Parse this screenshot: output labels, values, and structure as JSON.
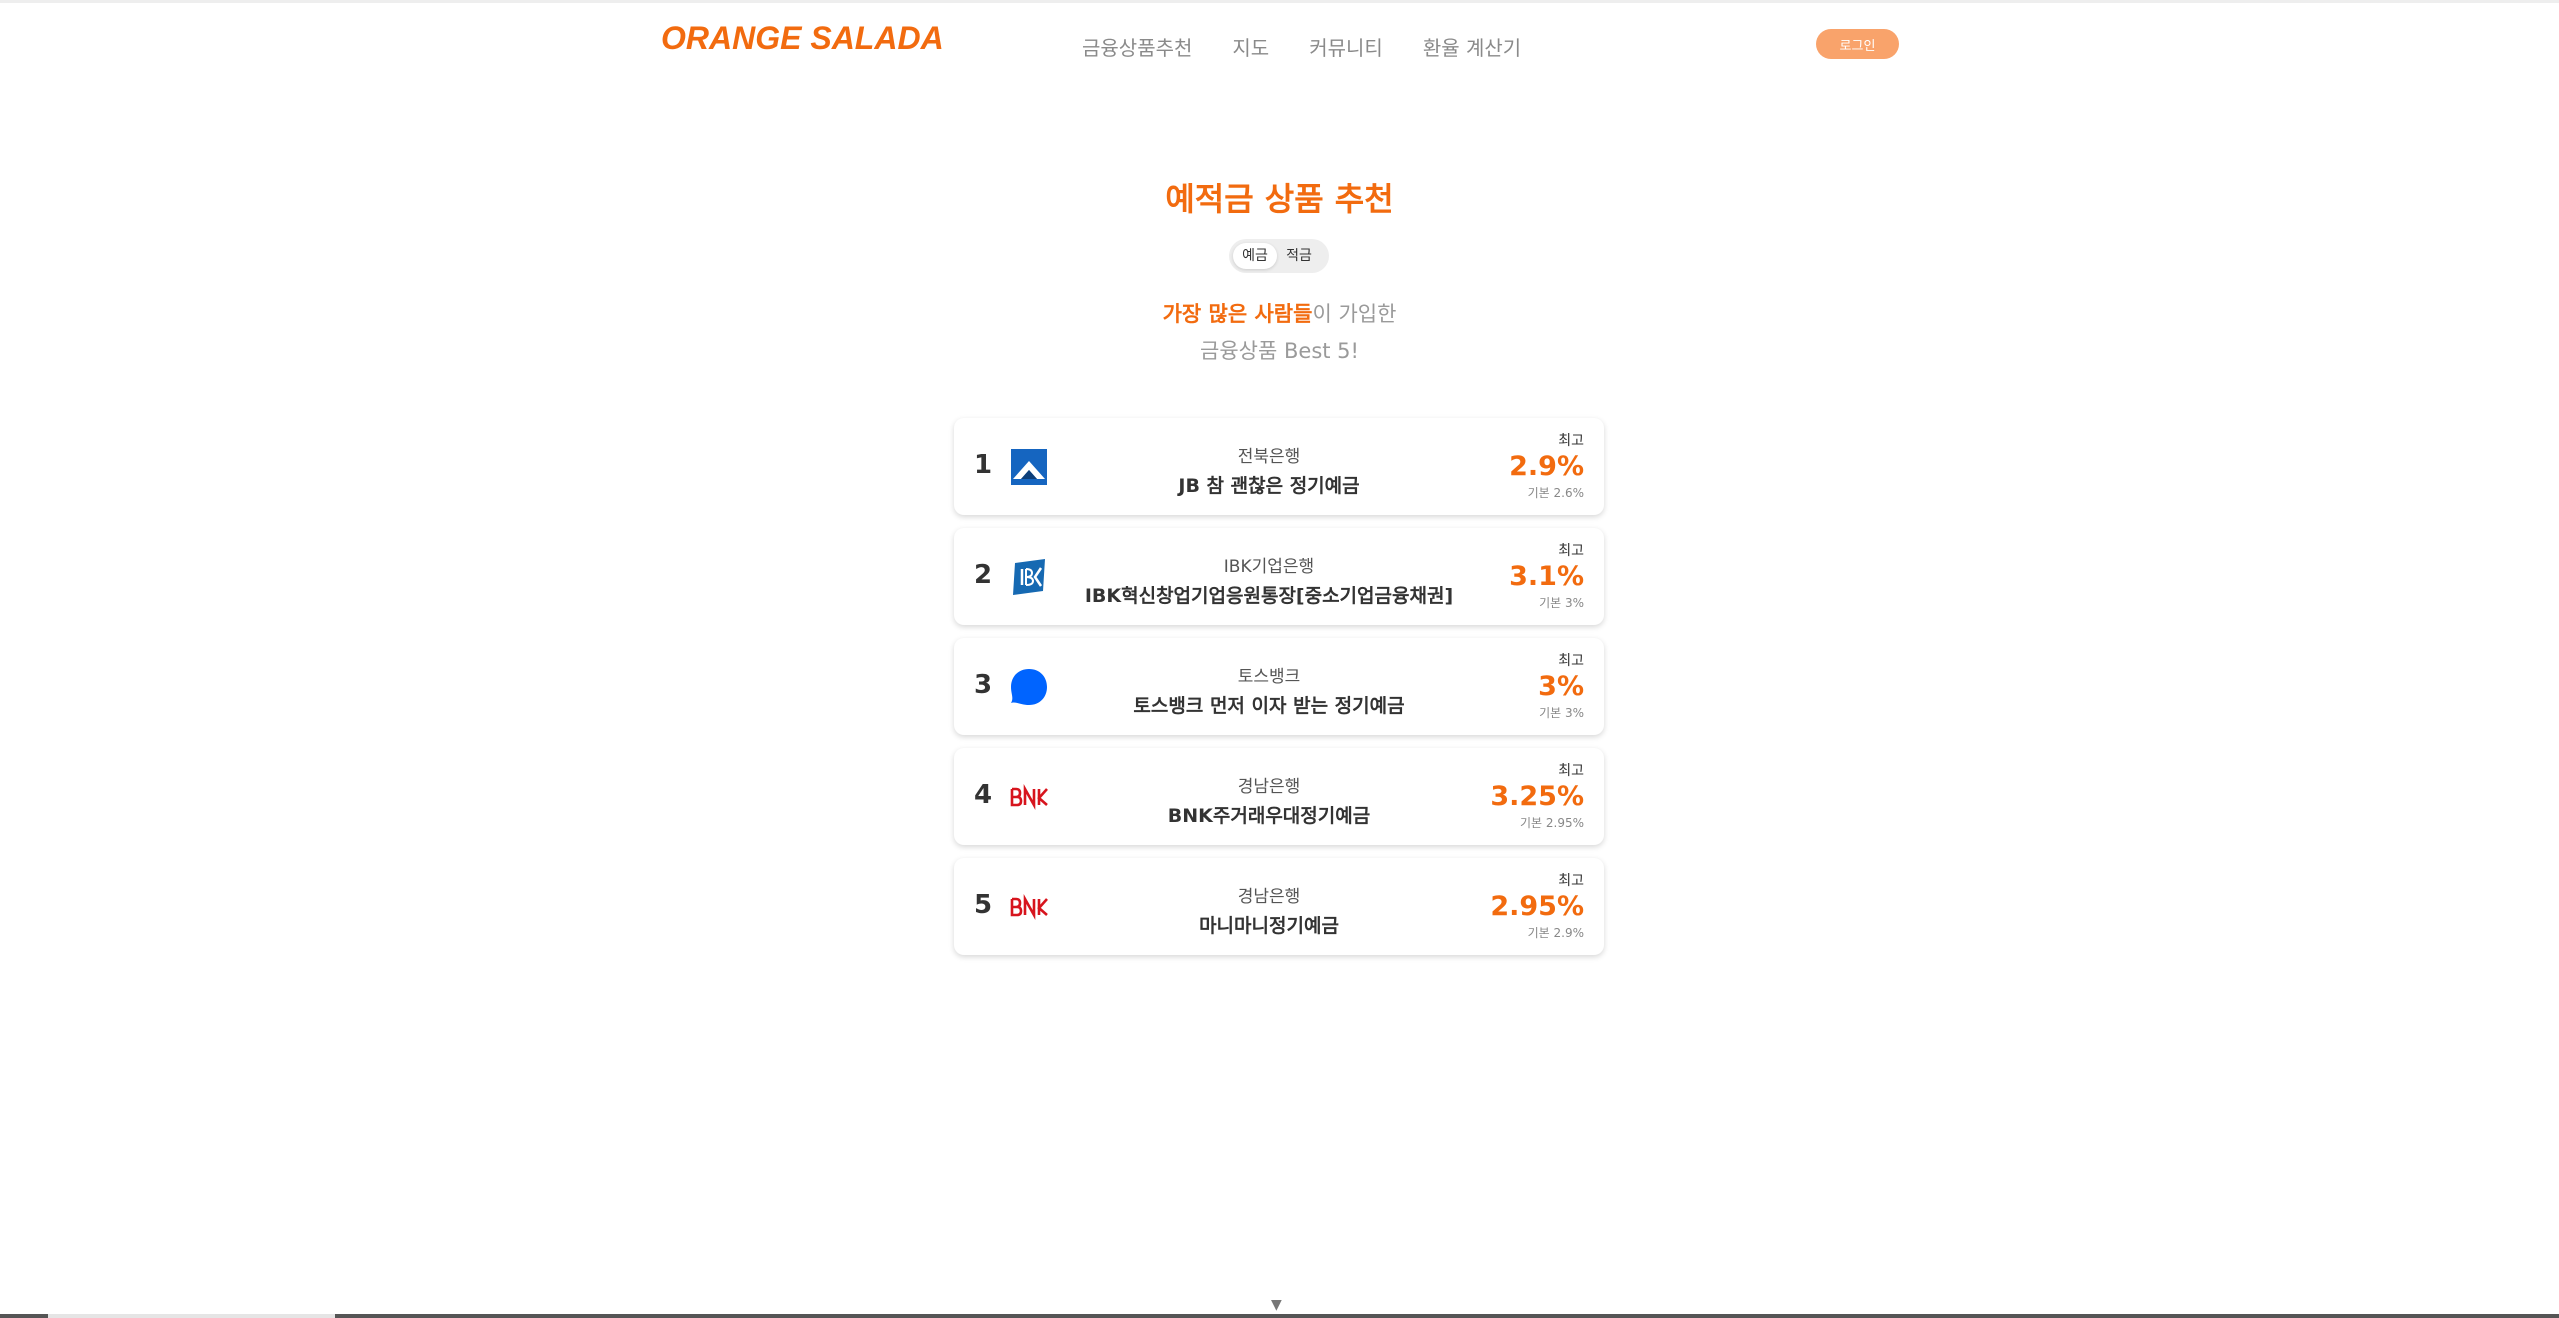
{
  "header": {
    "logo": "ORANGE SALADA",
    "nav": [
      "금융상품추천",
      "지도",
      "커뮤니티",
      "환율 계산기"
    ],
    "login_label": "로그인"
  },
  "main": {
    "title": "예적금 상품 추천",
    "toggle": [
      {
        "label": "예금",
        "active": true
      },
      {
        "label": "적금",
        "active": false
      }
    ],
    "subtitle_highlight": "가장 많은 사람들",
    "subtitle_rest": "이 가입한",
    "subtitle_line2": "금융상품 Best 5!"
  },
  "products": [
    {
      "rank": "1",
      "logo_icon": "jb-bank-logo-icon",
      "bank": "전북은행",
      "name": "JB 참 괜찮은 정기예금",
      "max_label": "최고",
      "max_rate": "2.9%",
      "base_rate": "기본 2.6%"
    },
    {
      "rank": "2",
      "logo_icon": "ibk-logo-icon",
      "bank": "IBK기업은행",
      "name": "IBK혁신창업기업응원통장[중소기업금융채권]",
      "max_label": "최고",
      "max_rate": "3.1%",
      "base_rate": "기본 3%"
    },
    {
      "rank": "3",
      "logo_icon": "toss-logo-icon",
      "bank": "토스뱅크",
      "name": "토스뱅크 먼저 이자 받는 정기예금",
      "max_label": "최고",
      "max_rate": "3%",
      "base_rate": "기본 3%"
    },
    {
      "rank": "4",
      "logo_icon": "bnk-logo-icon",
      "bank": "경남은행",
      "name": "BNK주거래우대정기예금",
      "max_label": "최고",
      "max_rate": "3.25%",
      "base_rate": "기본 2.95%"
    },
    {
      "rank": "5",
      "logo_icon": "bnk-logo-icon",
      "bank": "경남은행",
      "name": "마니마니정기예금",
      "max_label": "최고",
      "max_rate": "2.95%",
      "base_rate": "기본 2.9%"
    }
  ],
  "colors": {
    "accent": "#f26b0f",
    "login_bg": "#f9a36b"
  }
}
